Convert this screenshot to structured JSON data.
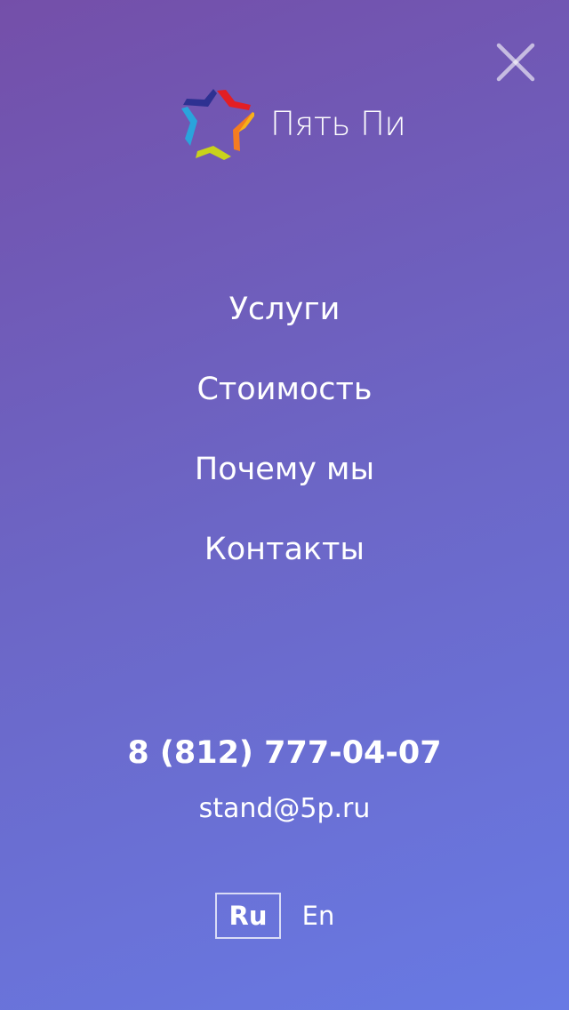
{
  "header": {
    "close_icon": "close-icon",
    "logo": {
      "icon": "star-logo-icon",
      "text": "Пять Пи",
      "colors": [
        "#e31e24",
        "#f47c20",
        "#c9d21b",
        "#2aa4dc",
        "#2e3192"
      ]
    }
  },
  "menu": {
    "items": [
      {
        "label": "Услуги"
      },
      {
        "label": "Стоимость"
      },
      {
        "label": "Почему мы"
      },
      {
        "label": "Контакты"
      }
    ]
  },
  "contacts": {
    "phone": "8 (812) 777-04-07",
    "email": "stand@5p.ru"
  },
  "language": {
    "options": [
      {
        "label": "Ru",
        "active": true
      },
      {
        "label": "En",
        "active": false
      }
    ]
  },
  "colors": {
    "gradient_start": "#744fa9",
    "gradient_end": "#687ae4",
    "text": "#ffffff"
  }
}
